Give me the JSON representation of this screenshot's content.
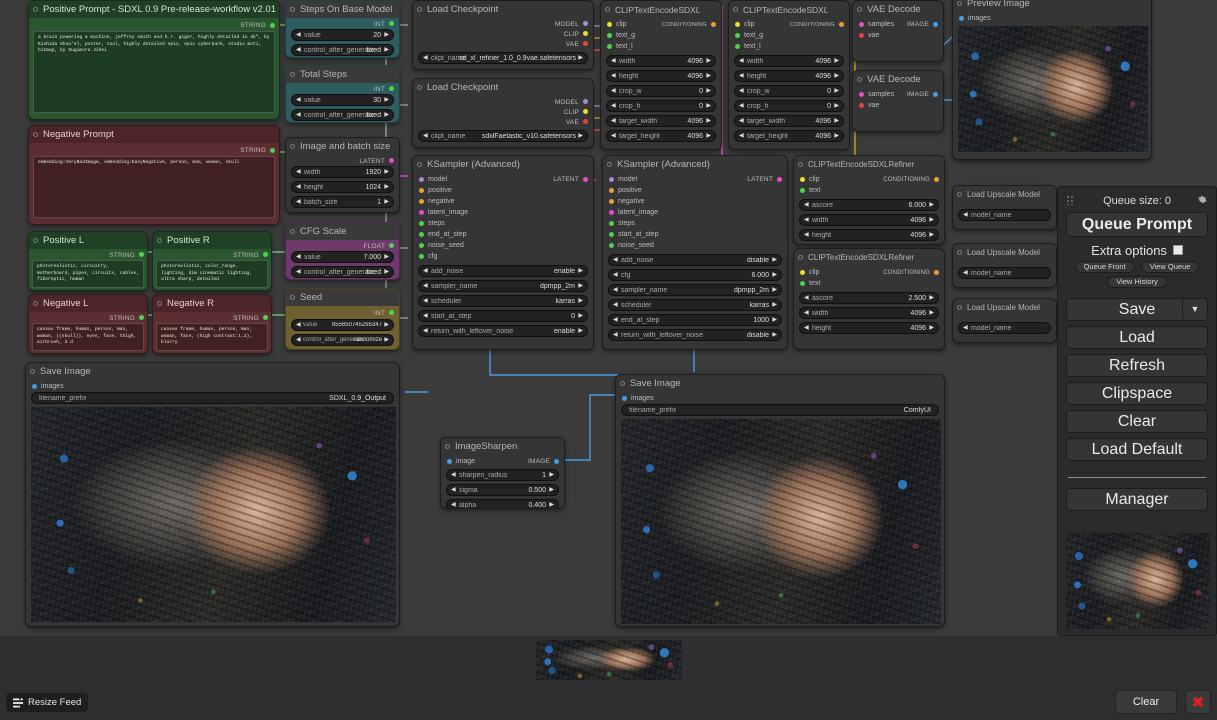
{
  "app": {
    "name": "ComfyUI"
  },
  "nodes": {
    "positive_prompt": {
      "title": "Positive Prompt - SDXL 0.9 Pre-release-workflow v2.01",
      "type_label": "STRING",
      "text": "a brain powering a machine, jeffrey smith and h.r. giger, highly detailed in 4k\", by Kishida Shou'el, poster, tool, highly detailed epic, epic cyberpunk, studio moti, bitmap, by Sugimora Jihei"
    },
    "negative_prompt": {
      "title": "Negative Prompt",
      "type_label": "STRING",
      "text": "embedding:VeryBadImage, embedding:EasyNegative, person, man, woman, skull"
    },
    "positive_l": {
      "title": "Positive L",
      "type_label": "STRING",
      "text": "photorealistic, circuitry, motherboard, pipes, circuits, cables, fiberoptic, human"
    },
    "positive_r": {
      "title": "Positive R",
      "type_label": "STRING",
      "text": "photorealistic, color_range, lighting, dim cinematic lighting, ultra sharp, detailed"
    },
    "negative_l": {
      "title": "Negative L",
      "type_label": "STRING",
      "text": "canvas frame, human, person, man, woman, ((skull)), eyes, face, thigh, airbrush, 3 d"
    },
    "negative_r": {
      "title": "Negative R",
      "type_label": "STRING",
      "text": "canvas frame, human, person, man, woman, face, (high contrast:1.2), blurry"
    },
    "steps_on_base": {
      "title": "Steps On Base Model",
      "type_label": "INT",
      "widgets": [
        {
          "name": "value",
          "value": "20"
        },
        {
          "name": "control_after_generate",
          "value": "fixed"
        }
      ]
    },
    "total_steps": {
      "title": "Total Steps",
      "type_label": "INT",
      "widgets": [
        {
          "name": "value",
          "value": "30"
        },
        {
          "name": "control_after_generate",
          "value": "fixed"
        }
      ]
    },
    "image_batch_size": {
      "title": "Image and batch size",
      "type_label": "LATENT",
      "widgets": [
        {
          "name": "width",
          "value": "1920"
        },
        {
          "name": "height",
          "value": "1024"
        },
        {
          "name": "batch_size",
          "value": "1"
        }
      ]
    },
    "cfg_scale": {
      "title": "CFG Scale",
      "type_label": "FLOAT",
      "widgets": [
        {
          "name": "value",
          "value": "7.000"
        },
        {
          "name": "control_after_generate",
          "value": "fixed"
        }
      ]
    },
    "seed": {
      "title": "Seed",
      "type_label": "INT",
      "widgets": [
        {
          "name": "value",
          "value": "855650745295347"
        },
        {
          "name": "control_after_generate",
          "value": "randomize"
        }
      ]
    },
    "load_checkpoint_1": {
      "title": "Load Checkpoint",
      "outputs": [
        "MODEL",
        "CLIP",
        "VAE"
      ],
      "widgets": [
        {
          "name": "ckpt_name",
          "value": "sd_xl_refiner_1.0_0.9vae.safetensors"
        }
      ]
    },
    "load_checkpoint_2": {
      "title": "Load Checkpoint",
      "outputs": [
        "MODEL",
        "CLIP",
        "VAE"
      ],
      "widgets": [
        {
          "name": "ckpt_name",
          "value": "sdxlFaetastic_v10.safetensors"
        }
      ]
    },
    "ksampler_base": {
      "title": "KSampler (Advanced)",
      "inputs": [
        "model",
        "positive",
        "negative",
        "latent_image",
        "steps",
        "end_at_step",
        "noise_seed",
        "cfg"
      ],
      "outputs": [
        "LATENT"
      ],
      "widgets": [
        {
          "name": "add_noise",
          "value": "enable"
        },
        {
          "name": "sampler_name",
          "value": "dpmpp_2m"
        },
        {
          "name": "scheduler",
          "value": "karras"
        },
        {
          "name": "start_at_step",
          "value": "0"
        },
        {
          "name": "return_with_leftover_noise",
          "value": "enable"
        }
      ]
    },
    "ksampler_refiner": {
      "title": "KSampler (Advanced)",
      "inputs": [
        "model",
        "positive",
        "negative",
        "latent_image",
        "steps",
        "start_at_step",
        "noise_seed"
      ],
      "outputs": [
        "LATENT"
      ],
      "widgets": [
        {
          "name": "add_noise",
          "value": "disable"
        },
        {
          "name": "cfg",
          "value": "6.000"
        },
        {
          "name": "sampler_name",
          "value": "dpmpp_2m"
        },
        {
          "name": "scheduler",
          "value": "karras"
        },
        {
          "name": "end_at_step",
          "value": "1000"
        },
        {
          "name": "return_with_leftover_noise",
          "value": "disable"
        }
      ]
    },
    "clip_sdxl_1": {
      "title": "CLIPTextEncodeSDXL",
      "inputs": [
        "clip",
        "text_g",
        "text_l"
      ],
      "outputs": [
        "CONDITIONING"
      ],
      "widgets": [
        {
          "name": "width",
          "value": "4096"
        },
        {
          "name": "height",
          "value": "4096"
        },
        {
          "name": "crop_w",
          "value": "0"
        },
        {
          "name": "crop_h",
          "value": "0"
        },
        {
          "name": "target_width",
          "value": "4096"
        },
        {
          "name": "target_height",
          "value": "4096"
        }
      ]
    },
    "clip_sdxl_2": {
      "title": "CLIPTextEncodeSDXL",
      "inputs": [
        "clip",
        "text_g",
        "text_l"
      ],
      "outputs": [
        "CONDITIONING"
      ],
      "widgets": [
        {
          "name": "width",
          "value": "4096"
        },
        {
          "name": "height",
          "value": "4096"
        },
        {
          "name": "crop_w",
          "value": "0"
        },
        {
          "name": "crop_h",
          "value": "0"
        },
        {
          "name": "target_width",
          "value": "4096"
        },
        {
          "name": "target_height",
          "value": "4096"
        }
      ]
    },
    "clip_refiner_1": {
      "title": "CLIPTextEncodeSDXLRefiner",
      "inputs": [
        "clip",
        "text"
      ],
      "outputs": [
        "CONDITIONING"
      ],
      "widgets": [
        {
          "name": "ascore",
          "value": "6.000"
        },
        {
          "name": "width",
          "value": "4096"
        },
        {
          "name": "height",
          "value": "4096"
        }
      ]
    },
    "clip_refiner_2": {
      "title": "CLIPTextEncodeSDXLRefiner",
      "inputs": [
        "clip",
        "text"
      ],
      "outputs": [
        "CONDITIONING"
      ],
      "widgets": [
        {
          "name": "ascore",
          "value": "2.500"
        },
        {
          "name": "width",
          "value": "4096"
        },
        {
          "name": "height",
          "value": "4096"
        }
      ]
    },
    "vae_decode_1": {
      "title": "VAE Decode",
      "inputs": [
        "samples",
        "vae"
      ],
      "outputs": [
        "IMAGE"
      ]
    },
    "vae_decode_2": {
      "title": "VAE Decode",
      "inputs": [
        "samples",
        "vae"
      ],
      "outputs": [
        "IMAGE"
      ]
    },
    "preview_image": {
      "title": "Preview Image",
      "inputs": [
        "images"
      ]
    },
    "save_image_1": {
      "title": "Save Image",
      "inputs": [
        "images"
      ],
      "widgets": [
        {
          "name": "filename_prefix",
          "value": "SDXL_0.9_Output"
        }
      ]
    },
    "save_image_2": {
      "title": "Save Image",
      "inputs": [
        "images"
      ],
      "widgets": [
        {
          "name": "filename_prefix",
          "value": "ComfyUI"
        }
      ]
    },
    "image_sharpen": {
      "title": "ImageSharpen",
      "inputs": [
        "image"
      ],
      "outputs": [
        "IMAGE"
      ],
      "widgets": [
        {
          "name": "sharpen_radius",
          "value": "1"
        },
        {
          "name": "sigma",
          "value": "0.500"
        },
        {
          "name": "alpha",
          "value": "0.400"
        }
      ]
    },
    "upscale_1": {
      "title": "Load Upscale Model",
      "widgets": [
        {
          "name": "model_name",
          "value": ""
        }
      ]
    },
    "upscale_2": {
      "title": "Load Upscale Model",
      "widgets": [
        {
          "name": "model_name",
          "value": ""
        }
      ]
    },
    "upscale_3": {
      "title": "Load Upscale Model",
      "widgets": [
        {
          "name": "model_name",
          "value": ""
        }
      ]
    }
  },
  "sidebar": {
    "queue_size_label": "Queue size: 0",
    "gear_icon": "gear-icon",
    "queue_prompt": "Queue Prompt",
    "extra_options": "Extra options",
    "queue_front": "Queue Front",
    "view_queue": "View Queue",
    "view_history": "View History",
    "save": "Save",
    "save_caret": "▼",
    "load": "Load",
    "refresh": "Refresh",
    "clipspace": "Clipspace",
    "clear": "Clear",
    "load_default": "Load Default",
    "manager": "Manager"
  },
  "bottom_bar": {
    "resize_feed": "Resize Feed",
    "resize_icon": "resize-icon",
    "clear": "Clear",
    "close": "✖"
  },
  "colors": {
    "canvas_bg": "#3b3b3b",
    "node_bg": "#353535",
    "accent_green": "#2a5630",
    "accent_red": "#5d2e31",
    "accent_teal": "#2e5c5f",
    "accent_purple": "#6d3a6b",
    "accent_olive": "#6e6030",
    "link_blue": "#4a9ce0",
    "link_pink": "#e24fc6",
    "link_orange": "#d4a017",
    "close_red": "#e02020"
  }
}
